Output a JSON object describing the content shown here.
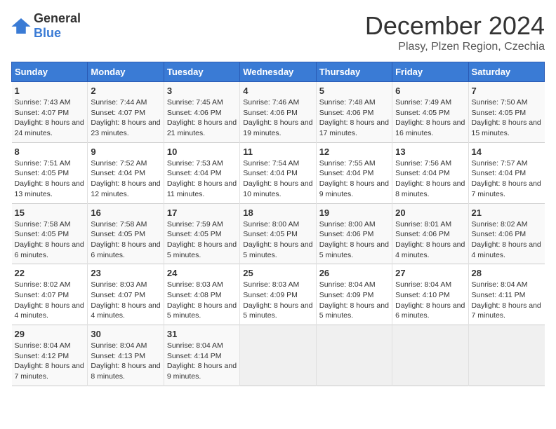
{
  "header": {
    "logo_general": "General",
    "logo_blue": "Blue",
    "month_title": "December 2024",
    "location": "Plasy, Plzen Region, Czechia"
  },
  "weekdays": [
    "Sunday",
    "Monday",
    "Tuesday",
    "Wednesday",
    "Thursday",
    "Friday",
    "Saturday"
  ],
  "weeks": [
    [
      {
        "day": "1",
        "sunrise": "7:43 AM",
        "sunset": "4:07 PM",
        "daylight": "8 hours and 24 minutes."
      },
      {
        "day": "2",
        "sunrise": "7:44 AM",
        "sunset": "4:07 PM",
        "daylight": "8 hours and 23 minutes."
      },
      {
        "day": "3",
        "sunrise": "7:45 AM",
        "sunset": "4:06 PM",
        "daylight": "8 hours and 21 minutes."
      },
      {
        "day": "4",
        "sunrise": "7:46 AM",
        "sunset": "4:06 PM",
        "daylight": "8 hours and 19 minutes."
      },
      {
        "day": "5",
        "sunrise": "7:48 AM",
        "sunset": "4:06 PM",
        "daylight": "8 hours and 17 minutes."
      },
      {
        "day": "6",
        "sunrise": "7:49 AM",
        "sunset": "4:05 PM",
        "daylight": "8 hours and 16 minutes."
      },
      {
        "day": "7",
        "sunrise": "7:50 AM",
        "sunset": "4:05 PM",
        "daylight": "8 hours and 15 minutes."
      }
    ],
    [
      {
        "day": "8",
        "sunrise": "7:51 AM",
        "sunset": "4:05 PM",
        "daylight": "8 hours and 13 minutes."
      },
      {
        "day": "9",
        "sunrise": "7:52 AM",
        "sunset": "4:04 PM",
        "daylight": "8 hours and 12 minutes."
      },
      {
        "day": "10",
        "sunrise": "7:53 AM",
        "sunset": "4:04 PM",
        "daylight": "8 hours and 11 minutes."
      },
      {
        "day": "11",
        "sunrise": "7:54 AM",
        "sunset": "4:04 PM",
        "daylight": "8 hours and 10 minutes."
      },
      {
        "day": "12",
        "sunrise": "7:55 AM",
        "sunset": "4:04 PM",
        "daylight": "8 hours and 9 minutes."
      },
      {
        "day": "13",
        "sunrise": "7:56 AM",
        "sunset": "4:04 PM",
        "daylight": "8 hours and 8 minutes."
      },
      {
        "day": "14",
        "sunrise": "7:57 AM",
        "sunset": "4:04 PM",
        "daylight": "8 hours and 7 minutes."
      }
    ],
    [
      {
        "day": "15",
        "sunrise": "7:58 AM",
        "sunset": "4:05 PM",
        "daylight": "8 hours and 6 minutes."
      },
      {
        "day": "16",
        "sunrise": "7:58 AM",
        "sunset": "4:05 PM",
        "daylight": "8 hours and 6 minutes."
      },
      {
        "day": "17",
        "sunrise": "7:59 AM",
        "sunset": "4:05 PM",
        "daylight": "8 hours and 5 minutes."
      },
      {
        "day": "18",
        "sunrise": "8:00 AM",
        "sunset": "4:05 PM",
        "daylight": "8 hours and 5 minutes."
      },
      {
        "day": "19",
        "sunrise": "8:00 AM",
        "sunset": "4:06 PM",
        "daylight": "8 hours and 5 minutes."
      },
      {
        "day": "20",
        "sunrise": "8:01 AM",
        "sunset": "4:06 PM",
        "daylight": "8 hours and 4 minutes."
      },
      {
        "day": "21",
        "sunrise": "8:02 AM",
        "sunset": "4:06 PM",
        "daylight": "8 hours and 4 minutes."
      }
    ],
    [
      {
        "day": "22",
        "sunrise": "8:02 AM",
        "sunset": "4:07 PM",
        "daylight": "8 hours and 4 minutes."
      },
      {
        "day": "23",
        "sunrise": "8:03 AM",
        "sunset": "4:07 PM",
        "daylight": "8 hours and 4 minutes."
      },
      {
        "day": "24",
        "sunrise": "8:03 AM",
        "sunset": "4:08 PM",
        "daylight": "8 hours and 5 minutes."
      },
      {
        "day": "25",
        "sunrise": "8:03 AM",
        "sunset": "4:09 PM",
        "daylight": "8 hours and 5 minutes."
      },
      {
        "day": "26",
        "sunrise": "8:04 AM",
        "sunset": "4:09 PM",
        "daylight": "8 hours and 5 minutes."
      },
      {
        "day": "27",
        "sunrise": "8:04 AM",
        "sunset": "4:10 PM",
        "daylight": "8 hours and 6 minutes."
      },
      {
        "day": "28",
        "sunrise": "8:04 AM",
        "sunset": "4:11 PM",
        "daylight": "8 hours and 7 minutes."
      }
    ],
    [
      {
        "day": "29",
        "sunrise": "8:04 AM",
        "sunset": "4:12 PM",
        "daylight": "8 hours and 7 minutes."
      },
      {
        "day": "30",
        "sunrise": "8:04 AM",
        "sunset": "4:13 PM",
        "daylight": "8 hours and 8 minutes."
      },
      {
        "day": "31",
        "sunrise": "8:04 AM",
        "sunset": "4:14 PM",
        "daylight": "8 hours and 9 minutes."
      },
      null,
      null,
      null,
      null
    ]
  ],
  "labels": {
    "sunrise_prefix": "Sunrise: ",
    "sunset_prefix": "Sunset: ",
    "daylight_prefix": "Daylight: "
  }
}
